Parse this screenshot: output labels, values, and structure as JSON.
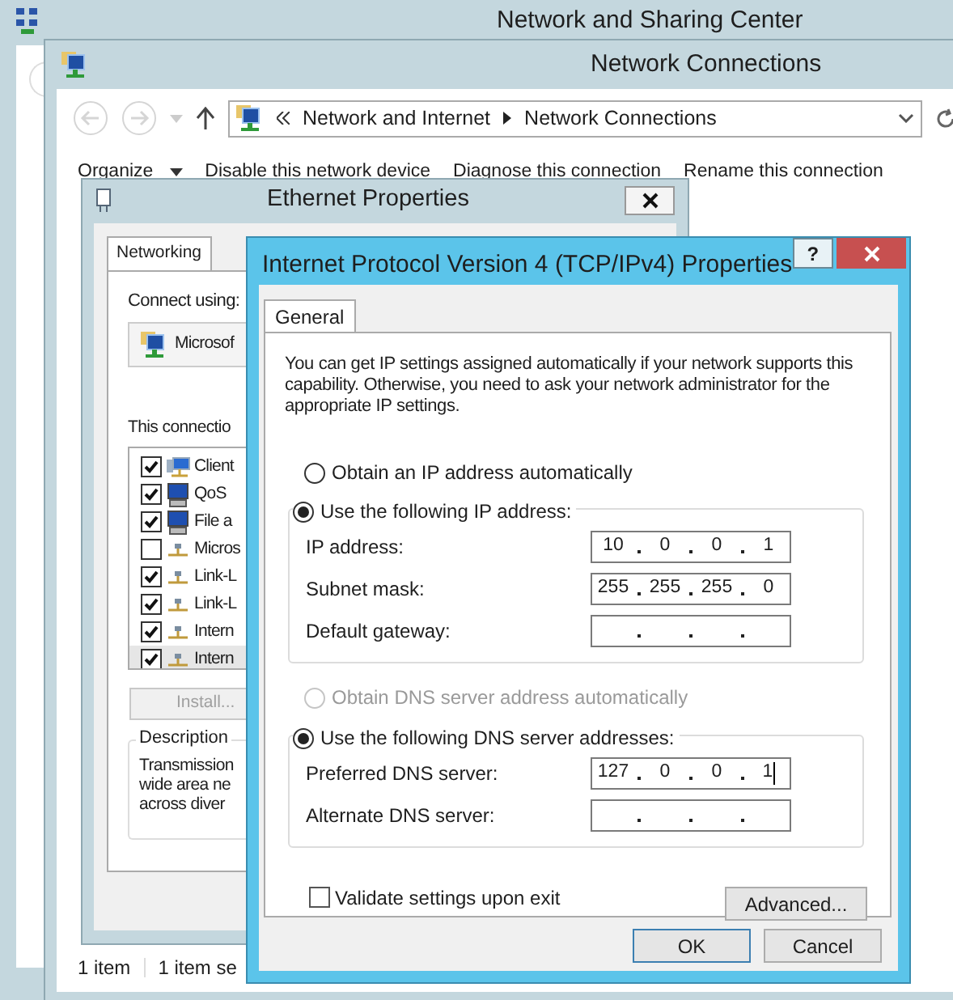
{
  "background_window": {
    "title": "Network and Sharing Center"
  },
  "explorer": {
    "title": "Network Connections",
    "breadcrumb": [
      {
        "label": "Network and Internet"
      },
      {
        "label": "Network Connections"
      }
    ],
    "toolbar": [
      {
        "label": "Organize",
        "has_menu": true
      },
      {
        "label": "Disable this network device",
        "has_menu": false
      },
      {
        "label": "Diagnose this connection",
        "has_menu": false
      },
      {
        "label": "Rename this connection",
        "has_menu": false
      }
    ],
    "status_bar": [
      "1 item",
      "1 item se"
    ]
  },
  "ethernet_properties": {
    "title": "Ethernet Properties",
    "tabs": [
      {
        "label": "Networking",
        "selected": true
      }
    ],
    "connect_using_label": "Connect using:",
    "adapter": "Microsof",
    "items_label": "This connectio",
    "items": [
      {
        "label": "Client",
        "checked": true,
        "selected": false,
        "kind": "client"
      },
      {
        "label": "QoS",
        "checked": true,
        "selected": false,
        "kind": "service"
      },
      {
        "label": "File a",
        "checked": true,
        "selected": false,
        "kind": "service"
      },
      {
        "label": "Micros",
        "checked": false,
        "selected": false,
        "kind": "protocol"
      },
      {
        "label": "Link-L",
        "checked": true,
        "selected": false,
        "kind": "protocol"
      },
      {
        "label": "Link-L",
        "checked": true,
        "selected": false,
        "kind": "protocol"
      },
      {
        "label": "Intern",
        "checked": true,
        "selected": false,
        "kind": "protocol"
      },
      {
        "label": "Intern",
        "checked": true,
        "selected": true,
        "kind": "protocol"
      }
    ],
    "install_button": {
      "label": "Install...",
      "disabled": true
    },
    "description_title": "Description",
    "description_lines": [
      "Transmission",
      "wide area ne",
      "across diver"
    ]
  },
  "ipv4_dialog": {
    "title": "Internet Protocol Version 4 (TCP/IPv4) Properties",
    "help_button": "?",
    "tabs": [
      {
        "label": "General",
        "selected": true
      }
    ],
    "intro": "You can get IP settings assigned automatically if your network supports this capability. Otherwise, you need to ask your network administrator for the appropriate IP settings.",
    "ip_options": [
      {
        "label": "Obtain an IP address automatically",
        "selected": false,
        "disabled": false
      },
      {
        "label": "Use the following IP address:",
        "selected": true,
        "disabled": false
      }
    ],
    "ip_fields": [
      {
        "label": "IP address:",
        "octets": [
          "10",
          "0",
          "0",
          "1"
        ],
        "focused": false
      },
      {
        "label": "Subnet mask:",
        "octets": [
          "255",
          "255",
          "255",
          "0"
        ],
        "focused": false
      },
      {
        "label": "Default gateway:",
        "focused": false
      }
    ],
    "dns_options": [
      {
        "label": "Obtain DNS server address automatically",
        "selected": false,
        "disabled": true
      },
      {
        "label": "Use the following DNS server addresses:",
        "selected": true,
        "disabled": false
      }
    ],
    "dns_fields": [
      {
        "label": "Preferred DNS server:",
        "octets": [
          "127",
          "0",
          "0",
          "1"
        ],
        "focused": true
      },
      {
        "label": "Alternate DNS server:",
        "focused": false
      }
    ],
    "validate": {
      "label": "Validate settings upon exit",
      "checked": false
    },
    "advanced_button": "Advanced...",
    "buttons": [
      {
        "label": "OK",
        "default": true
      },
      {
        "label": "Cancel",
        "default": false
      }
    ]
  }
}
